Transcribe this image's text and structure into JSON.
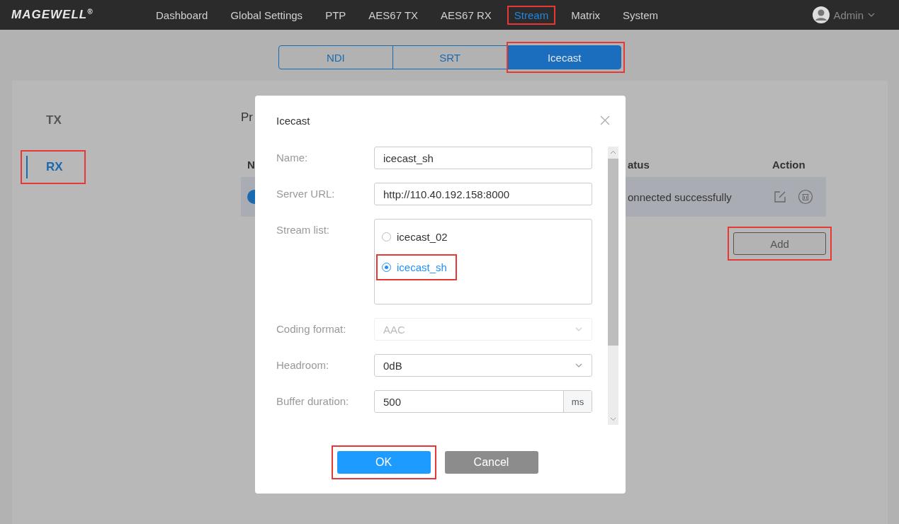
{
  "nav": {
    "logo": "MAGEWELL",
    "logo_mark": "®",
    "items": [
      {
        "label": "Dashboard",
        "selected": false,
        "highlighted": false
      },
      {
        "label": "Global Settings",
        "selected": false,
        "highlighted": false
      },
      {
        "label": "PTP",
        "selected": false,
        "highlighted": false
      },
      {
        "label": "AES67 TX",
        "selected": false,
        "highlighted": false
      },
      {
        "label": "AES67 RX",
        "selected": false,
        "highlighted": false
      },
      {
        "label": "Stream",
        "selected": true,
        "highlighted": true
      },
      {
        "label": "Matrix",
        "selected": false,
        "highlighted": false
      },
      {
        "label": "System",
        "selected": false,
        "highlighted": false
      }
    ],
    "user": {
      "name": "Admin"
    }
  },
  "stream_tabs": [
    {
      "label": "NDI",
      "selected": false,
      "highlighted": false
    },
    {
      "label": "SRT",
      "selected": false,
      "highlighted": false
    },
    {
      "label": "Icecast",
      "selected": true,
      "highlighted": true
    }
  ],
  "sidebar": {
    "items": [
      {
        "label": "TX",
        "selected": false,
        "highlighted": false
      },
      {
        "label": "RX",
        "selected": true,
        "highlighted": true
      }
    ]
  },
  "content": {
    "heading": "Pr",
    "columns": [
      "N",
      "atus",
      "Action"
    ],
    "rows": [
      {
        "on": true,
        "status": "onnected successfully"
      }
    ],
    "add_button": {
      "label": "Add",
      "highlighted": true
    }
  },
  "dialog": {
    "title": "Icecast",
    "fields": [
      {
        "kind": "text",
        "label": "Name:",
        "value": "icecast_sh"
      },
      {
        "kind": "text",
        "label": "Server URL:",
        "value": "http://110.40.192.158:8000"
      },
      {
        "kind": "radio-list",
        "label": "Stream list:",
        "options": [
          {
            "label": "icecast_02",
            "selected": false,
            "highlighted": false
          },
          {
            "label": "icecast_sh",
            "selected": true,
            "highlighted": true
          }
        ]
      },
      {
        "kind": "select",
        "label": "Coding format:",
        "value": "AAC",
        "disabled": true
      },
      {
        "kind": "select",
        "label": "Headroom:",
        "value": "0dB",
        "disabled": false
      },
      {
        "kind": "addon",
        "label": "Buffer duration:",
        "value": "500",
        "unit": "ms"
      }
    ],
    "buttons": [
      {
        "label": "OK",
        "kind": "primary",
        "highlighted": true
      },
      {
        "label": "Cancel",
        "kind": "secondary",
        "highlighted": false
      }
    ]
  }
}
